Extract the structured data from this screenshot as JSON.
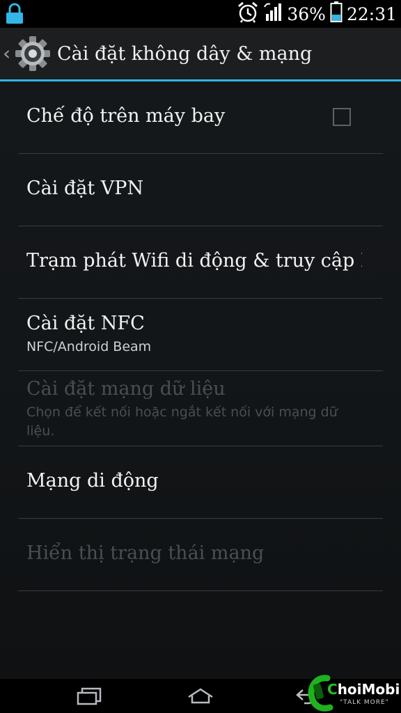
{
  "status_bar": {
    "icons": [
      "lock-icon",
      "alarm-clock-icon",
      "wifi-data-icon",
      "signal-icon",
      "battery-icon"
    ],
    "battery": "36%",
    "time": "22:31"
  },
  "action_bar": {
    "title": "Cài đặt không dây & mạng",
    "icon": "settings-gear-icon"
  },
  "settings": [
    {
      "title": "Chế độ trên máy bay",
      "summary": "",
      "checked": false,
      "enabled": true
    },
    {
      "title": "Cài đặt VPN",
      "summary": "",
      "enabled": true
    },
    {
      "title": "Trạm phát Wifi di động & truy cập In",
      "summary": "",
      "enabled": true
    },
    {
      "title": "Cài đặt NFC",
      "summary": "NFC/Android Beam",
      "enabled": true
    },
    {
      "title": "Cài đặt mạng dữ liệu",
      "summary": "Chọn để kết nối hoặc ngắt kết nối với mạng dữ liệu.",
      "enabled": false
    },
    {
      "title": "Mạng di động",
      "summary": "",
      "enabled": true
    },
    {
      "title": "Hiển thị trạng thái mạng",
      "summary": "",
      "enabled": false
    }
  ],
  "nav_bar": {
    "icons": [
      "recent-apps-icon",
      "home-icon",
      "back-icon"
    ]
  },
  "watermark": {
    "brand_prefix": "C",
    "brand_rest": "hoiMobile",
    "tagline": "\"TALK MORE\""
  }
}
